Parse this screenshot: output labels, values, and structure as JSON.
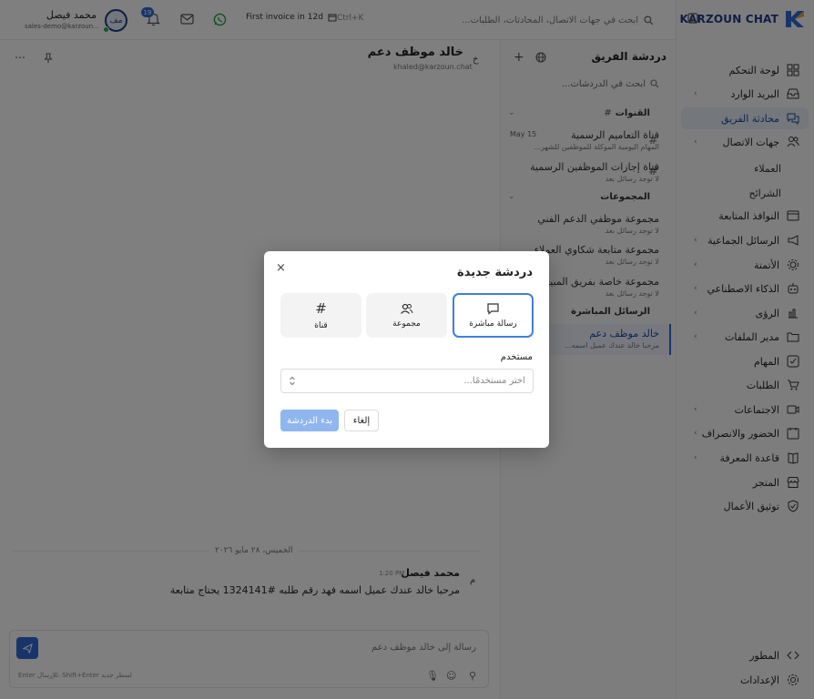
{
  "app": {
    "brand": "KARZOUN CHAT"
  },
  "sidebar": {
    "items": [
      {
        "label": "لوحة التحكم",
        "icon": "dashboard-icon",
        "chevron": false
      },
      {
        "label": "البريد الوارد",
        "icon": "inbox-icon",
        "chevron": true
      },
      {
        "label": "محادثة الفريق",
        "icon": "team-chat-icon",
        "chevron": false,
        "active": true
      },
      {
        "label": "جهات الاتصال",
        "icon": "contacts-icon",
        "chevron": true
      },
      {
        "label": "النوافذ المتابعة",
        "icon": "window-icon",
        "chevron": false
      },
      {
        "label": "الرسائل الجماعية",
        "icon": "megaphone-icon",
        "chevron": true
      },
      {
        "label": "الأتمتة",
        "icon": "automation-icon",
        "chevron": true
      },
      {
        "label": "الذكاء الاصطناعي",
        "icon": "robot-icon",
        "chevron": true
      },
      {
        "label": "الرؤى",
        "icon": "chart-icon",
        "chevron": true
      },
      {
        "label": "مدير الملفات",
        "icon": "folder-icon",
        "chevron": true
      },
      {
        "label": "المهام",
        "icon": "tasks-icon",
        "chevron": false
      },
      {
        "label": "الطلبات",
        "icon": "cart-icon",
        "chevron": false
      },
      {
        "label": "الاجتماعات",
        "icon": "video-icon",
        "chevron": true
      },
      {
        "label": "الحضور والانصراف",
        "icon": "attendance-icon",
        "chevron": true
      },
      {
        "label": "قاعدة المعرفة",
        "icon": "book-icon",
        "chevron": true
      },
      {
        "label": "المتجر",
        "icon": "store-icon",
        "chevron": false
      },
      {
        "label": "توثيق الأعمال",
        "icon": "shield-icon",
        "chevron": false
      }
    ],
    "subitems": [
      "العملاء",
      "الشرائح"
    ],
    "bottom": [
      {
        "label": "المطور",
        "icon": "code-icon"
      },
      {
        "label": "الإعدادات",
        "icon": "gear-icon"
      }
    ]
  },
  "topbar": {
    "search_placeholder": "ابحث في جهات الاتصال، المحادثات، الطلبات...",
    "shortcut": "Ctrl+K",
    "invoice_text": "First invoice in 12d",
    "notif_count": "19",
    "user_name": "محمد فيصل",
    "user_email": "sales-demo@karzoun...",
    "avatar_initials": "مف"
  },
  "chats": {
    "title": "دردشة الفريق",
    "search_placeholder": "ابحث في الدردشات...",
    "groups": [
      {
        "name": "القنوات",
        "items": [
          {
            "title": "قناة التعاميم الرسمية",
            "subtitle": "المهام اليومية الموكلة للموظفين للشهر...",
            "date": "May 15",
            "icon": "#"
          },
          {
            "title": "قناة إجازات الموظفين الرسمية",
            "subtitle": "لا توجد رسائل بعد",
            "date": "",
            "icon": "#"
          }
        ]
      },
      {
        "name": "المجموعات",
        "items": [
          {
            "title": "مجموعة موظفي الدعم الفني",
            "subtitle": "لا توجد رسائل بعد",
            "date": "",
            "icon": "group"
          },
          {
            "title": "مجموعة متابعة شكاوي العملاء",
            "subtitle": "لا توجد رسائل بعد",
            "date": "",
            "icon": "group"
          },
          {
            "title": "مجموعة خاصة بفريق المبيعات",
            "subtitle": "لا توجد رسائل بعد",
            "date": "",
            "icon": "group"
          }
        ]
      },
      {
        "name": "الرسائل المباشرة",
        "items": [
          {
            "title": "خالد موظف دعم",
            "subtitle": "مرحبا خالد عندك عميل اسمه...",
            "date": "",
            "icon": "خ"
          }
        ]
      }
    ]
  },
  "conversation": {
    "name": "خالد موظف دعم",
    "email": "khaled@karzoun.chat",
    "avatar": "خ",
    "date_divider": "الخميس، ٢٨ مايو ٢٠٢٦",
    "messages": [
      {
        "author": "محمد فيصل",
        "time": "1:20 PM",
        "avatar": "م",
        "text": "مرحبا خالد عندك عميل اسمه فهد رقم طلبه #1324141 يحتاج متابعة"
      }
    ],
    "composer_placeholder": "رسالة إلى خالد موظف دعم",
    "composer_hint": "Enter للإرسال، Shift+Enter لسطر جديد"
  },
  "modal": {
    "title": "دردشة جديدة",
    "options": [
      {
        "label": "رسالة مباشرة",
        "icon": "message-icon",
        "selected": true
      },
      {
        "label": "مجموعة",
        "icon": "users-icon",
        "selected": false
      },
      {
        "label": "قناة",
        "icon": "hash-icon",
        "selected": false
      }
    ],
    "user_label": "مستخدم",
    "user_placeholder": "اختر مستخدمًا...",
    "start_button": "بدء الدردشة",
    "cancel_button": "إلغاء"
  }
}
